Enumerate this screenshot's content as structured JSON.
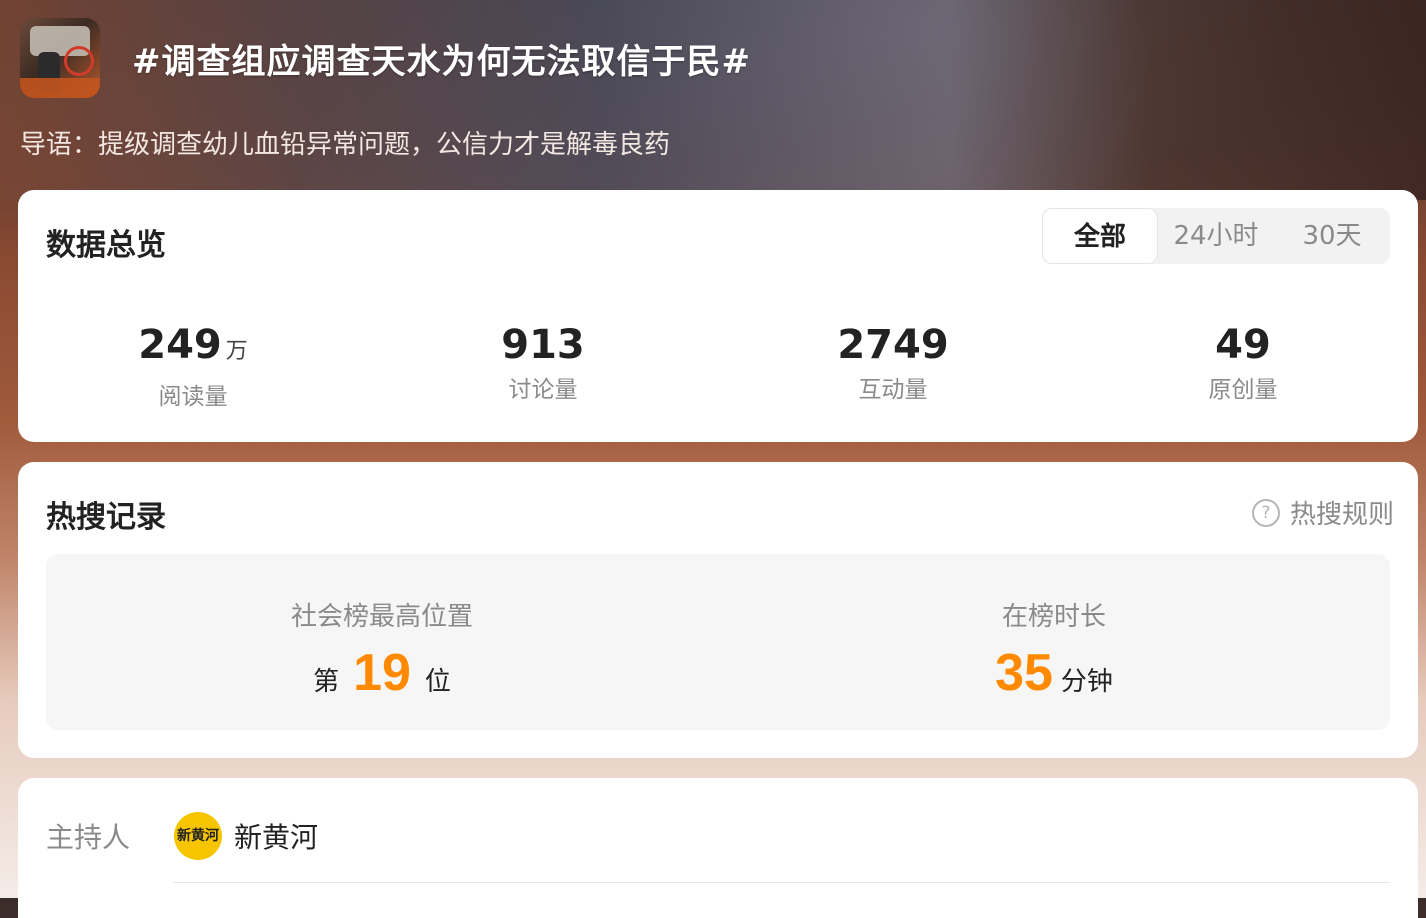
{
  "header": {
    "title": "#调查组应调查天水为何无法取信于民#",
    "lead": "导语：提级调查幼儿血铅异常问题，公信力才是解毒良药"
  },
  "overview": {
    "title": "数据总览",
    "tabs": [
      "全部",
      "24小时",
      "30天"
    ],
    "active_tab": "全部",
    "stats": [
      {
        "value": "249",
        "unit": "万",
        "label": "阅读量"
      },
      {
        "value": "913",
        "unit": "",
        "label": "讨论量"
      },
      {
        "value": "2749",
        "unit": "",
        "label": "互动量"
      },
      {
        "value": "49",
        "unit": "",
        "label": "原创量"
      }
    ]
  },
  "hot_search": {
    "title": "热搜记录",
    "rules_label": "热搜规则",
    "rank_label": "社会榜最高位置",
    "rank_prefix": "第",
    "rank_value": "19",
    "rank_suffix": "位",
    "duration_label": "在榜时长",
    "duration_value": "35",
    "duration_unit": "分钟"
  },
  "host": {
    "label": "主持人",
    "avatar_text": "新黄河",
    "name": "新黄河"
  },
  "colors": {
    "accent": "#ff8a00",
    "card": "#ffffff"
  }
}
